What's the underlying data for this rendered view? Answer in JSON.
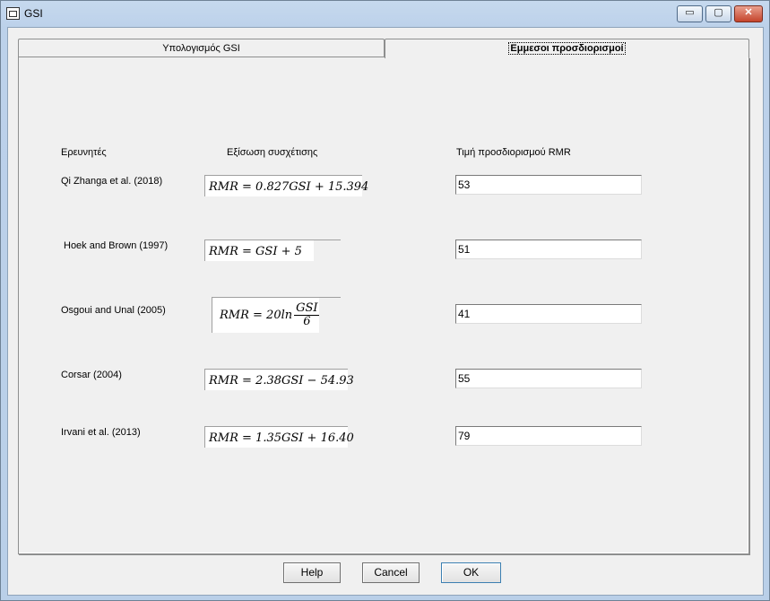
{
  "window": {
    "title": "GSI",
    "minimize": "▭",
    "maximize": "▢",
    "close": "✕"
  },
  "tabs": [
    {
      "label": "Υπολογισμός GSI"
    },
    {
      "label": "Εμμεσοι προσδιορισμοί"
    }
  ],
  "headers": {
    "researchers": "Ερευνητές",
    "equation": "Εξίσωση συσχέτισης",
    "value": "Τιμή προσδιορισμού RMR"
  },
  "rows": [
    {
      "researcher": "Qi Zhanga et al. (2018)",
      "equation": "RMR = 0.827GSI + 15.394",
      "value": "53"
    },
    {
      "researcher": "Hoek and Brown (1997)",
      "equation": "RMR = GSI + 5",
      "value": "51"
    },
    {
      "researcher": "Osgoui and Unal (2005)",
      "equation_prefix": "RMR = 20ln",
      "equation_num": "GSI",
      "equation_den": "6",
      "value": "41"
    },
    {
      "researcher": "Corsar (2004)",
      "equation": "RMR = 2.38GSI − 54.93",
      "value": "55"
    },
    {
      "researcher": "Irvani et al. (2013)",
      "equation": "RMR = 1.35GSI + 16.40",
      "value": "79"
    }
  ],
  "buttons": {
    "help": "Help",
    "cancel": "Cancel",
    "ok": "OK"
  }
}
